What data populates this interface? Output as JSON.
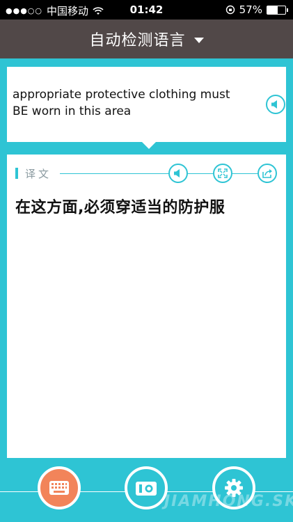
{
  "status_bar": {
    "signal": "●●●○○",
    "carrier": "中国移动",
    "time": "01:42",
    "battery": "57%",
    "battery_level": 0.57
  },
  "header": {
    "title": "自动检测语言"
  },
  "source": {
    "text": "appropriate protective clothing must BE worn in this area"
  },
  "result": {
    "label": "译文",
    "text": "在这方面,必须穿适当的防护服"
  },
  "footer": {
    "watermark": "JIAMHONG.SKY"
  },
  "colors": {
    "accent": "#2ec4d4",
    "header_bg": "#514848",
    "keyboard": "#f2845a"
  }
}
